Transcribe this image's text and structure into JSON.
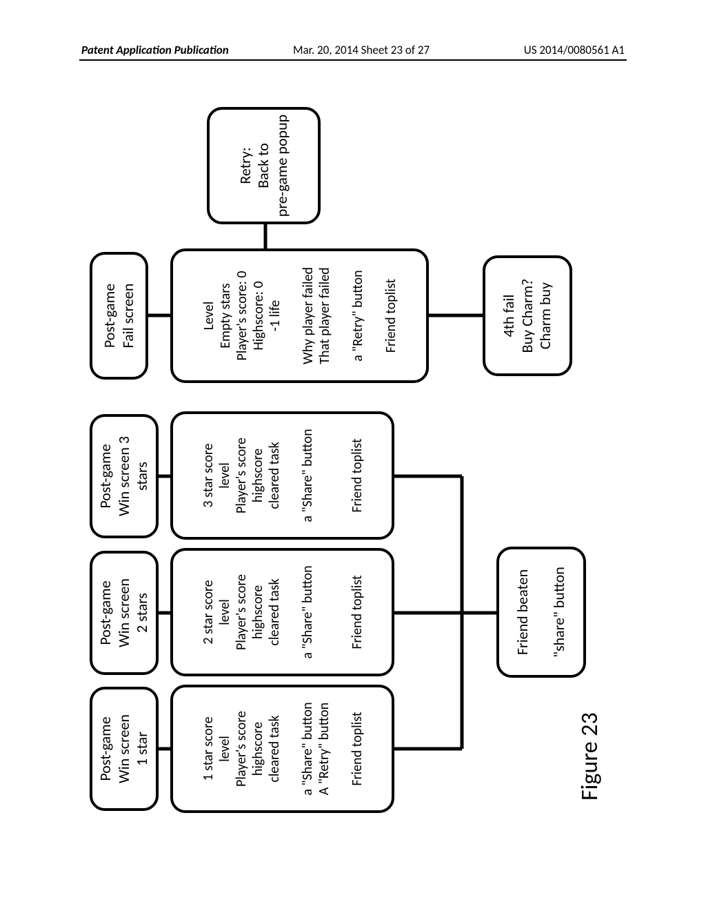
{
  "header": {
    "left": "Patent Application Publication",
    "mid": "Mar. 20, 2014  Sheet 23 of 27",
    "right": "US 2014/0080561 A1"
  },
  "figure_label": "Figure 23",
  "nodes": {
    "h1": [
      "Post-game",
      "Win screen",
      "1 star"
    ],
    "h2": [
      "Post-game",
      "Win screen",
      "2 stars"
    ],
    "h3": [
      "Post-game",
      "Win screen 3",
      "stars"
    ],
    "h4": [
      "Post-game",
      "Fail screen"
    ],
    "b1": [
      "1 star score",
      "level",
      "Player's score",
      "highscore",
      "cleared task",
      "",
      "a \"Share\" button",
      "A \"Retry\" button",
      "",
      "Friend toplist"
    ],
    "b2": [
      "2 star score",
      "level",
      "Player's score",
      "highscore",
      "cleared task",
      "",
      "a \"Share\" button",
      "",
      "",
      "Friend toplist"
    ],
    "b3": [
      "3 star score",
      "level",
      "Player's score",
      "highscore",
      "cleared task",
      "",
      "a \"Share\" button",
      "",
      "",
      "Friend toplist"
    ],
    "b4": [
      "Level",
      "Empty stars",
      "Player's score: 0",
      "Highscore: 0",
      "-1 life",
      "",
      "Why player failed",
      "That player failed",
      "",
      "a \"Retry\" button",
      "",
      "Friend toplist"
    ],
    "retry": [
      "Retry:",
      "Back to",
      "pre-game popup"
    ],
    "friend": [
      "Friend beaten",
      "",
      "\"share\" button"
    ],
    "charm": [
      "4th fail",
      "Buy Charm?",
      "Charm buy"
    ]
  }
}
